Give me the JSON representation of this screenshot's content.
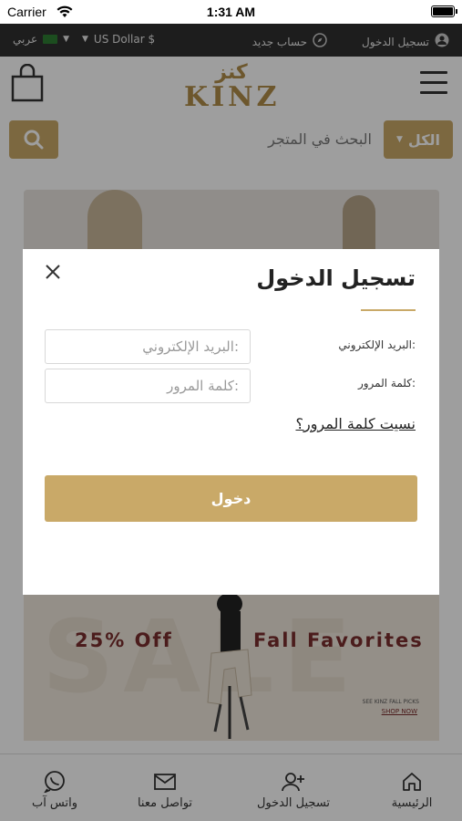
{
  "status_bar": {
    "carrier": "Carrier",
    "time": "1:31 AM"
  },
  "util_bar": {
    "login": "تسجيل الدخول",
    "register": "حساب جديد",
    "currency": "US Dollar $",
    "language": "عربي"
  },
  "header": {
    "logo_ar": "كنز",
    "logo_en": "KINZ"
  },
  "search": {
    "placeholder": "البحث في المتجر",
    "category": "الكل"
  },
  "banner_sale": {
    "left_text": "25% Off",
    "right_text": "Fall Favorites",
    "background_text": "SALE",
    "small_text": "SEE KINZ FALL PICKS",
    "shop_now": "SHOP NOW"
  },
  "bottom_nav": {
    "home": "الرئيسية",
    "register": "تسجيل الدخول",
    "contact": "تواصل معنا",
    "whatsapp": "واتس آب"
  },
  "modal": {
    "title": "تسجيل الدخول",
    "email_label": "البريد الإلكتروني:",
    "email_placeholder": "البريد الإلكتروني:",
    "password_label": "كلمة المرور:",
    "password_placeholder": "كلمة المرور:",
    "forgot": "نسيت كلمة المرور؟",
    "submit": "دخول"
  },
  "colors": {
    "accent": "#c9a968",
    "dark_bar": "#2f2f2f",
    "sale_text": "#7a2e2e"
  }
}
